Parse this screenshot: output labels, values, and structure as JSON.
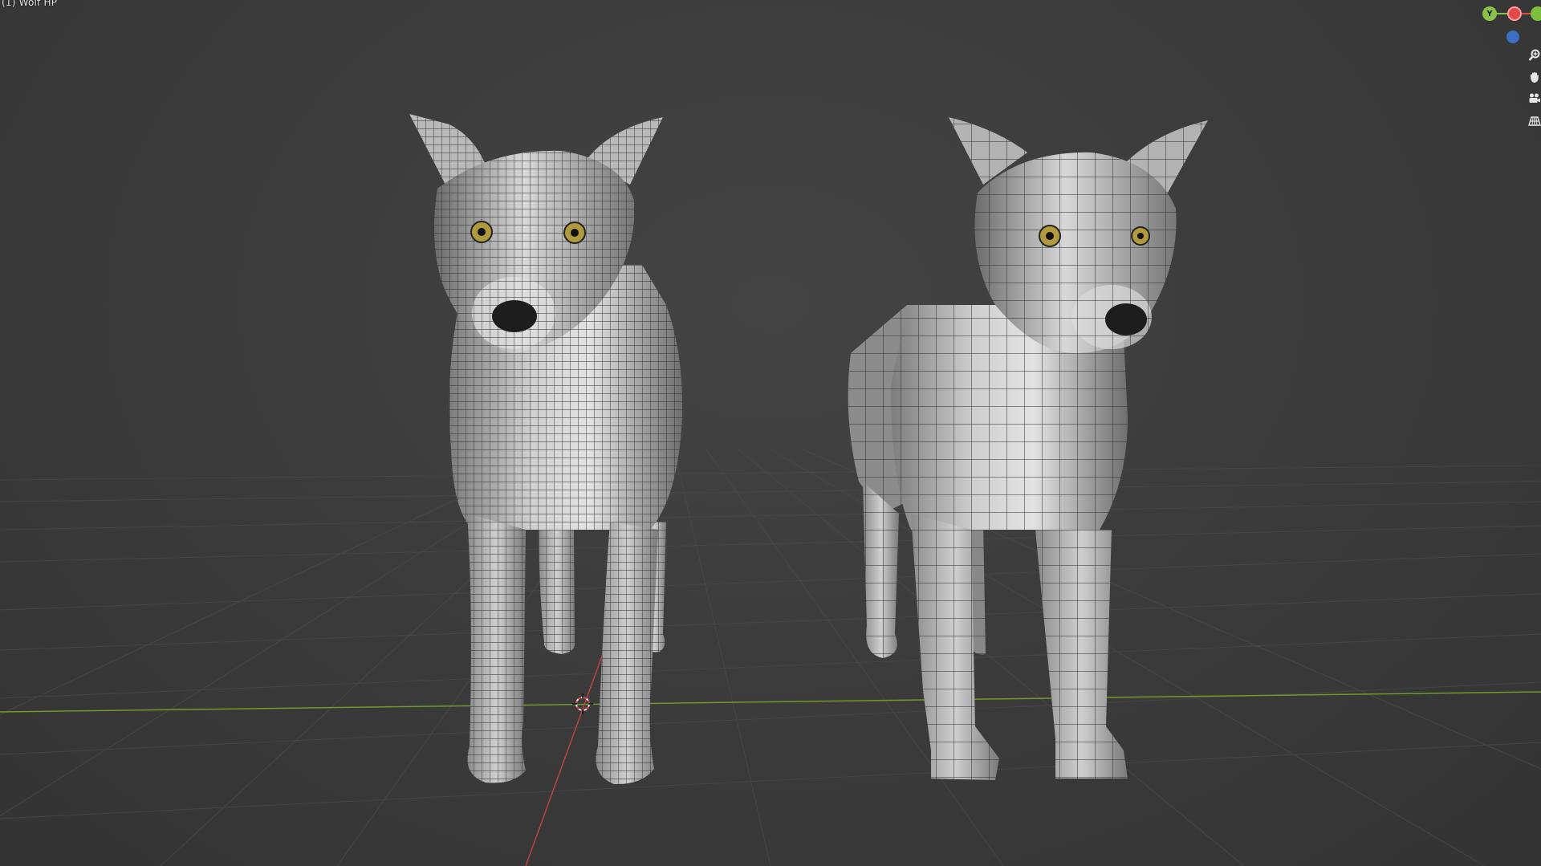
{
  "viewport": {
    "label": "(1) Wolf HP"
  },
  "gizmo": {
    "y_axis": "Y",
    "x_axis": "",
    "z_axis": "",
    "colors": {
      "x": "#e04a4a",
      "y": "#8bc34a",
      "z": "#3b6fbf"
    }
  },
  "nav": {
    "zoom": "zoom-icon",
    "pan": "hand-icon",
    "camera": "camera-icon",
    "ortho": "grid-icon"
  },
  "colors": {
    "background": "#393939",
    "grid": "#4a4a4a",
    "x_axis_line": "#b84545",
    "y_axis_line": "#6e9a2a",
    "wire": "#2c2c2c"
  }
}
